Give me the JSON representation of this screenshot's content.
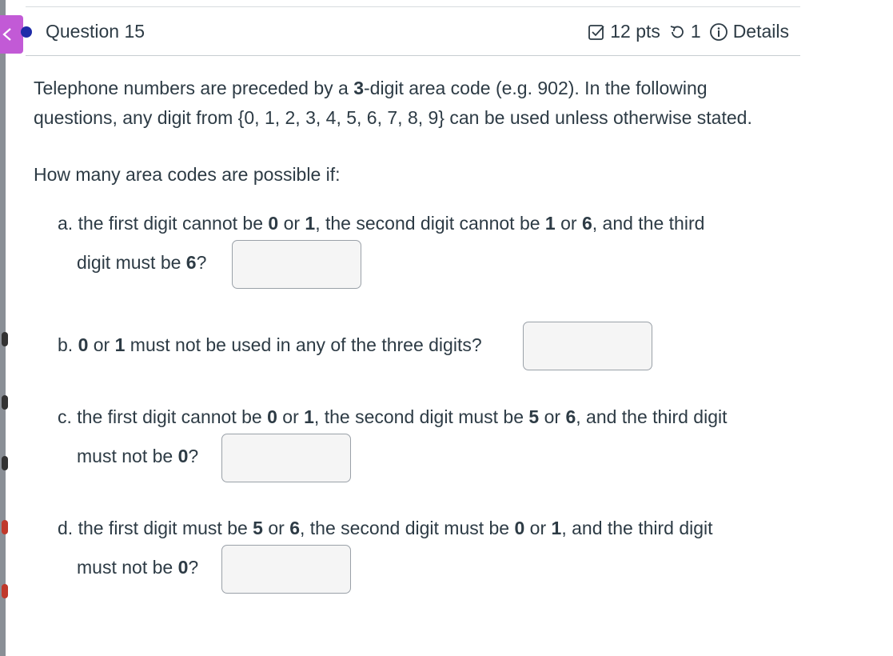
{
  "header": {
    "question_title": "Question 15",
    "points": "12 pts",
    "attempts": "1",
    "details_label": "Details"
  },
  "intro": {
    "line1_a": "Telephone numbers are preceded by a ",
    "line1_b": "3",
    "line1_c": "-digit area code (e.g. 902). In the following",
    "line2": "questions, any digit from {0, 1, 2, 3, 4, 5, 6, 7, 8, 9} can be used unless otherwise stated."
  },
  "ask": "How many area codes are possible if:",
  "parts": {
    "a": {
      "l1": [
        {
          "t": "a. the first digit cannot be ",
          "b": false
        },
        {
          "t": "0",
          "b": true
        },
        {
          "t": " or ",
          "b": false
        },
        {
          "t": "1",
          "b": true
        },
        {
          "t": ", the second digit cannot be ",
          "b": false
        },
        {
          "t": "1",
          "b": true
        },
        {
          "t": " or ",
          "b": false
        },
        {
          "t": "6",
          "b": true
        },
        {
          "t": ", and the third",
          "b": false
        }
      ],
      "l2": [
        {
          "t": "digit must be ",
          "b": false
        },
        {
          "t": "6",
          "b": true
        },
        {
          "t": "?",
          "b": false
        }
      ],
      "answer": ""
    },
    "b": {
      "l1": [
        {
          "t": "b. ",
          "b": false
        },
        {
          "t": "0",
          "b": true
        },
        {
          "t": " or ",
          "b": false
        },
        {
          "t": "1",
          "b": true
        },
        {
          "t": " must not be used in any of the three digits?",
          "b": false
        }
      ],
      "answer": ""
    },
    "c": {
      "l1": [
        {
          "t": "c. the first digit cannot be ",
          "b": false
        },
        {
          "t": "0",
          "b": true
        },
        {
          "t": " or ",
          "b": false
        },
        {
          "t": "1",
          "b": true
        },
        {
          "t": ", the second digit must be ",
          "b": false
        },
        {
          "t": "5",
          "b": true
        },
        {
          "t": " or ",
          "b": false
        },
        {
          "t": "6",
          "b": true
        },
        {
          "t": ", and the third digit",
          "b": false
        }
      ],
      "l2": [
        {
          "t": "must not be ",
          "b": false
        },
        {
          "t": "0",
          "b": true
        },
        {
          "t": "?",
          "b": false
        }
      ],
      "answer": ""
    },
    "d": {
      "l1": [
        {
          "t": "d. the first digit must be ",
          "b": false
        },
        {
          "t": "5",
          "b": true
        },
        {
          "t": " or ",
          "b": false
        },
        {
          "t": "6",
          "b": true
        },
        {
          "t": ", the second digit must be ",
          "b": false
        },
        {
          "t": "0",
          "b": true
        },
        {
          "t": " or ",
          "b": false
        },
        {
          "t": "1",
          "b": true
        },
        {
          "t": ", and the third digit",
          "b": false
        }
      ],
      "l2": [
        {
          "t": "must not be ",
          "b": false
        },
        {
          "t": "0",
          "b": true
        },
        {
          "t": "?",
          "b": false
        }
      ],
      "answer": ""
    }
  },
  "colors": {
    "accent_tab": "#c25ad6",
    "status_dot": "#1f2ba8",
    "text": "#2d3b45"
  }
}
